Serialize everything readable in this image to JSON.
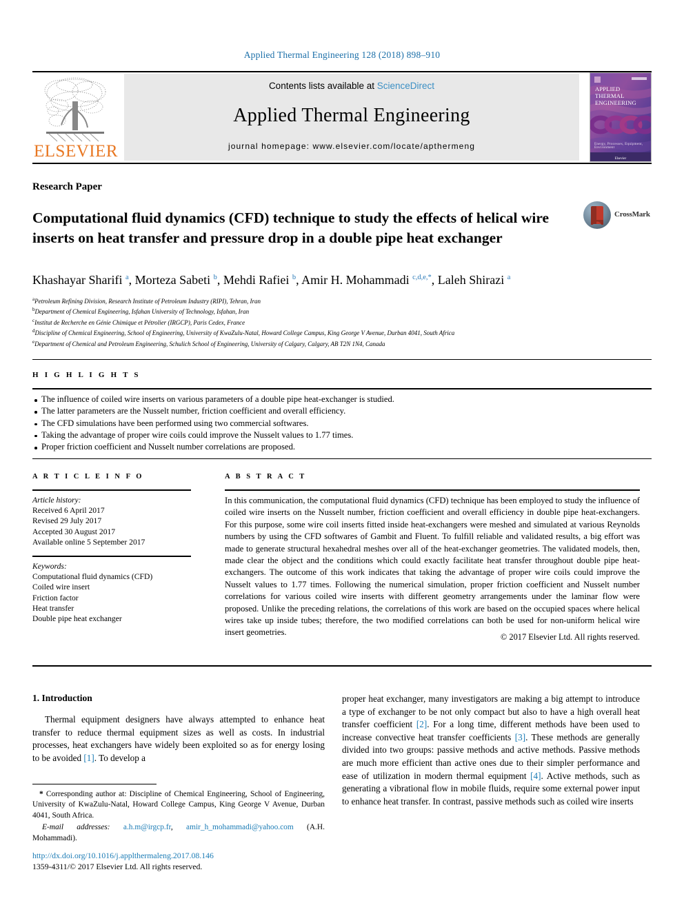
{
  "running_head": "Applied Thermal Engineering 128 (2018) 898–910",
  "header": {
    "contents_prefix": "Contents lists available at ",
    "sciencedirect": "ScienceDirect",
    "journal_title": "Applied Thermal Engineering",
    "homepage": "journal homepage: www.elsevier.com/locate/apthermeng",
    "publisher_logo_text": "ELSEVIER",
    "cover": {
      "line1": "APPLIED",
      "line2": "THERMAL",
      "line3": "ENGINEERING",
      "footer_note": "Energy, Processes, Equipment, Environment",
      "publisher": "Elsevier"
    },
    "accent_link_color": "#3b8fc4",
    "elsevier_orange": "#e87722"
  },
  "article": {
    "kind": "Research Paper",
    "title": "Computational fluid dynamics (CFD) technique to study the effects of helical wire inserts on heat transfer and pressure drop in a double pipe heat exchanger",
    "crossmark_label": "CrossMark",
    "authors_html": "Khashayar Sharifi <sup>a</sup>, Morteza Sabeti <sup>b</sup>, Mehdi Rafiei <sup>b</sup>, Amir H. Mohammadi <sup>c,d,e,*</sup>, Laleh Shirazi <sup>a</sup>",
    "affiliations": [
      {
        "marker": "a",
        "text": "Petroleum Refining Division, Research Institute of Petroleum Industry (RIPI), Tehran, Iran"
      },
      {
        "marker": "b",
        "text": "Department of Chemical Engineering, Isfahan University of Technology, Isfahan, Iran"
      },
      {
        "marker": "c",
        "text": "Institut de Recherche en Génie Chimique et Pétrolier (IRGCP), Paris Cedex, France"
      },
      {
        "marker": "d",
        "text": "Discipline of Chemical Engineering, School of Engineering, University of KwaZulu-Natal, Howard College Campus, King George V Avenue, Durban 4041, South Africa"
      },
      {
        "marker": "e",
        "text": "Department of Chemical and Petroleum Engineering, Schulich School of Engineering, University of Calgary, Calgary, AB T2N 1N4, Canada"
      }
    ]
  },
  "highlights": {
    "heading": "H I G H L I G H T S",
    "items": [
      "The influence of coiled wire inserts on various parameters of a double pipe heat-exchanger is studied.",
      "The latter parameters are the Nusselt number, friction coefficient and overall efficiency.",
      "The CFD simulations have been performed using two commercial softwares.",
      "Taking the advantage of proper wire coils could improve the Nusselt values to 1.77 times.",
      "Proper friction coefficient and Nusselt number correlations are proposed."
    ]
  },
  "article_info": {
    "heading": "A R T I C L E   I N F O",
    "history_label": "Article history:",
    "history": [
      "Received 6 April 2017",
      "Revised 29 July 2017",
      "Accepted 30 August 2017",
      "Available online 5 September 2017"
    ],
    "keywords_label": "Keywords:",
    "keywords": [
      "Computational fluid dynamics (CFD)",
      "Coiled wire insert",
      "Friction factor",
      "Heat transfer",
      "Double pipe heat exchanger"
    ]
  },
  "abstract": {
    "heading": "A B S T R A C T",
    "text": "In this communication, the computational fluid dynamics (CFD) technique has been employed to study the influence of coiled wire inserts on the Nusselt number, friction coefficient and overall efficiency in double pipe heat-exchangers. For this purpose, some wire coil inserts fitted inside heat-exchangers were meshed and simulated at various Reynolds numbers by using the CFD softwares of Gambit and Fluent. To fulfill reliable and validated results, a big effort was made to generate structural hexahedral meshes over all of the heat-exchanger geometries. The validated models, then, made clear the object and the conditions which could exactly facilitate heat transfer throughout double pipe heat-exchangers. The outcome of this work indicates that taking the advantage of proper wire coils could improve the Nusselt values to 1.77 times. Following the numerical simulation, proper friction coefficient and Nusselt number correlations for various coiled wire inserts with different geometry arrangements under the laminar flow were proposed. Unlike the preceding relations, the correlations of this work are based on the occupied spaces where helical wires take up inside tubes; therefore, the two modified correlations can both be used for non-uniform helical wire insert geometries.",
    "copyright": "© 2017 Elsevier Ltd. All rights reserved."
  },
  "body": {
    "section_number_title": "1. Introduction",
    "left_paragraph_html": "Thermal equipment designers have always attempted to enhance heat transfer to reduce thermal equipment sizes as well as costs. In industrial processes, heat exchangers have widely been exploited so as for energy losing to be avoided <span class=\"ref\">[1]</span>. To develop a",
    "right_paragraph_html": "proper heat exchanger, many investigators are making a big attempt to introduce a type of exchanger to be not only compact but also to have a high overall heat transfer coefficient <span class=\"ref\">[2]</span>. For a long time, different methods have been used to increase convective heat transfer coefficients <span class=\"ref\">[3]</span>. These methods are generally divided into two groups: passive methods and active methods. Passive methods are much more efficient than active ones due to their simpler performance and ease of utilization in modern thermal equipment <span class=\"ref\">[4]</span>. Active methods, such as generating a vibrational flow in mobile fluids, require some external power input to enhance heat transfer. In contrast, passive methods such as coiled wire inserts"
  },
  "footnotes": {
    "corresponding_html": "<b>*</b> Corresponding author at: Discipline of Chemical Engineering, School of Engineering, University of KwaZulu-Natal, Howard College Campus, King George V Avenue, Durban 4041, South Africa.",
    "email_label": "E-mail addresses:",
    "email1": "a.h.m@irgcp.fr",
    "email2": "amir_h_mohammadi@yahoo.com",
    "email_attrib": "(A.H. Mohammadi).",
    "doi": "http://dx.doi.org/10.1016/j.applthermaleng.2017.08.146",
    "issn_line": "1359-4311/© 2017 Elsevier Ltd. All rights reserved."
  }
}
